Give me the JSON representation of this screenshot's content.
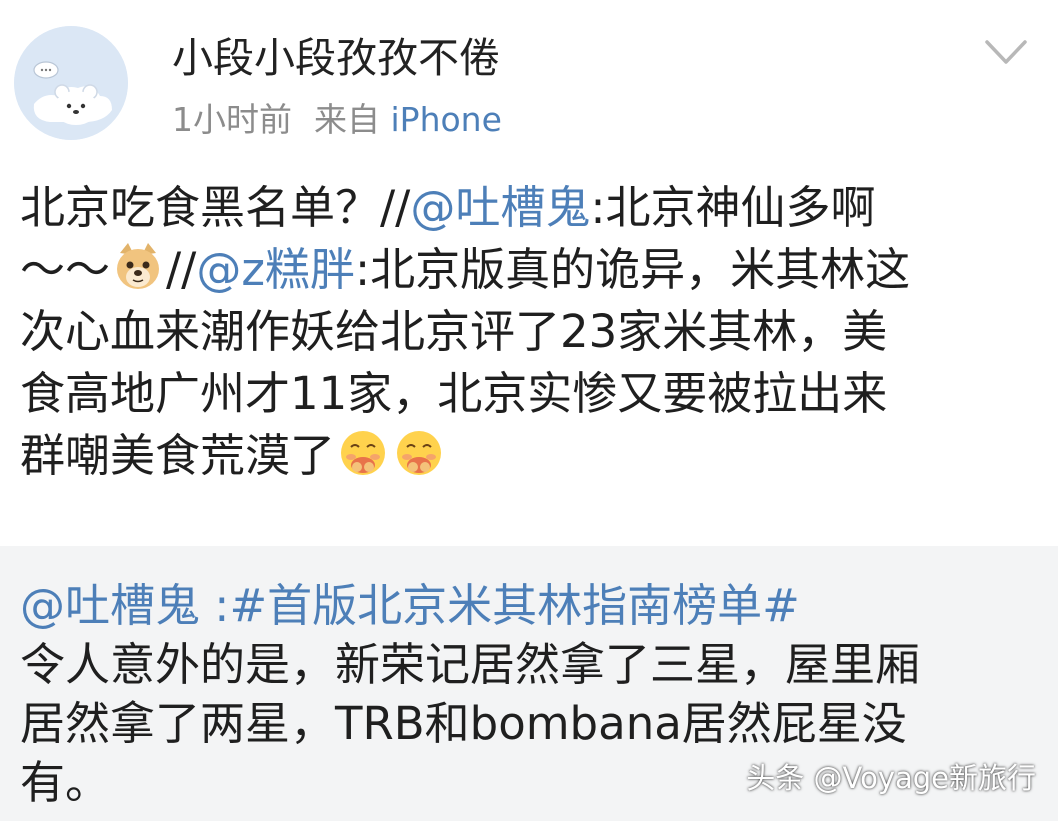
{
  "header": {
    "username": "小段小段孜孜不倦",
    "time": "1小时前",
    "from_label": "来自",
    "source": "iPhone"
  },
  "post": {
    "l1_text": "北京吃食黑名单？//",
    "l1_mention": "@吐槽鬼",
    "l1_rest": ":北京神仙多啊",
    "l2_text": "～～",
    "l2_sep": "//",
    "l2_mention": "@z糕胖",
    "l2_rest": ":北京版真的诡异，米其林这",
    "l3_text": "次心血来潮作妖给北京评了23家米其林，美",
    "l4_text": "食高地广州才11家，北京实惨又要被拉出来",
    "l5_text": "群嘲美食荒漠了"
  },
  "quote": {
    "mention": "@吐槽鬼 :#首版北京米其林指南榜单#",
    "l2": "令人意外的是，新荣记居然拿了三星，屋里厢",
    "l3": "居然拿了两星，TRB和bombana居然屁星没",
    "l4": "有。"
  },
  "watermark": "头条 @Voyage新旅行",
  "icons": {
    "avatar": "bear-avatar-icon",
    "menu": "chevron-down-icon",
    "emoji1": "doge-emoji-icon",
    "emoji2": "yummy-emoji-icon"
  },
  "colors": {
    "link": "#4d7fb8",
    "meta": "#8c8c8c",
    "quote_bg": "#f3f4f5"
  }
}
